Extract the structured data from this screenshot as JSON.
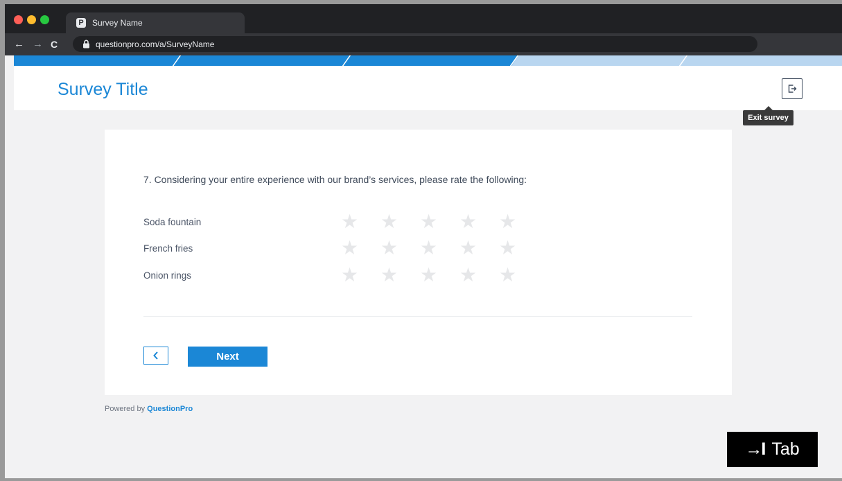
{
  "browser": {
    "tab_title": "Survey Name",
    "favicon_letter": "P",
    "url": "questionpro.com/a/SurveyName",
    "back_icon": "←",
    "forward_icon": "→",
    "reload_icon": "C"
  },
  "survey": {
    "title": "Survey Title",
    "exit_tooltip": "Exit survey",
    "question": "7. Considering your entire experience with our brand’s services, please rate the following:",
    "rows": [
      {
        "label": "Soda fountain",
        "rating": 0,
        "max": 5
      },
      {
        "label": "French fries",
        "rating": 0,
        "max": 5
      },
      {
        "label": "Onion rings",
        "rating": 0,
        "max": 5
      }
    ],
    "next_label": "Next",
    "back_icon": "‹",
    "powered_prefix": "Powered by",
    "powered_brand": "QuestionPro"
  },
  "overlay": {
    "tab_label": "Tab",
    "tab_arrow": "→I"
  },
  "colors": {
    "accent": "#1b87d6",
    "star_empty": "#e6e7e9",
    "stripe_dark": "#1b87d6",
    "stripe_light": "#b9d6f0"
  }
}
